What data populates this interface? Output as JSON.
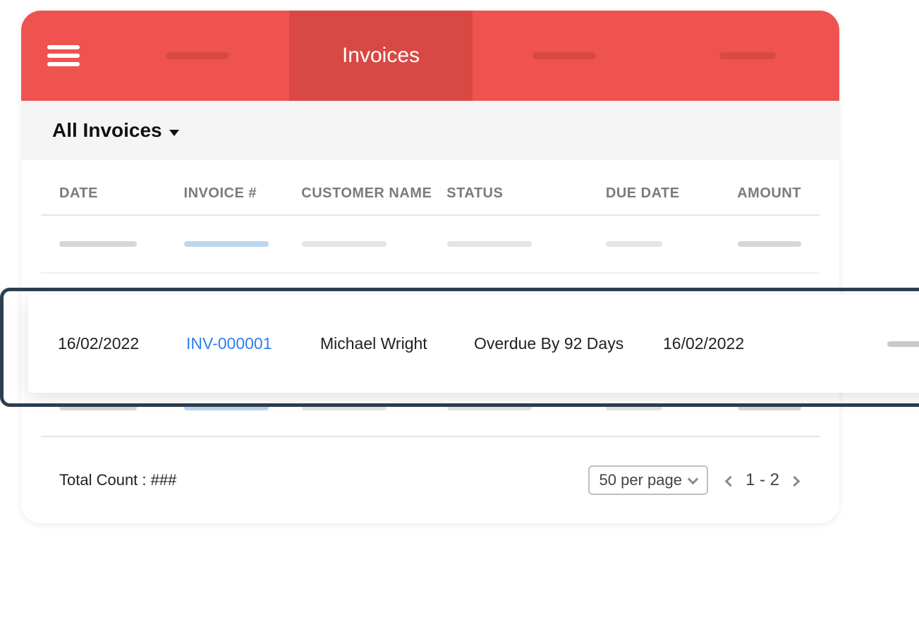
{
  "header": {
    "tabs": {
      "active_label": "Invoices"
    }
  },
  "filter": {
    "label": "All Invoices"
  },
  "table": {
    "columns": {
      "date": "DATE",
      "invoice": "INVOICE #",
      "customer": "CUSTOMER NAME",
      "status": "STATUS",
      "due_date": "DUE DATE",
      "amount": "AMOUNT"
    },
    "highlighted_row": {
      "date": "16/02/2022",
      "invoice": "INV-000001",
      "customer": "Michael Wright",
      "status": "Overdue By 92 Days",
      "due_date": "16/02/2022"
    }
  },
  "footer": {
    "total_count_label": "Total Count : ###",
    "per_page_label": "50 per page",
    "page_range": "1 - 2"
  }
}
